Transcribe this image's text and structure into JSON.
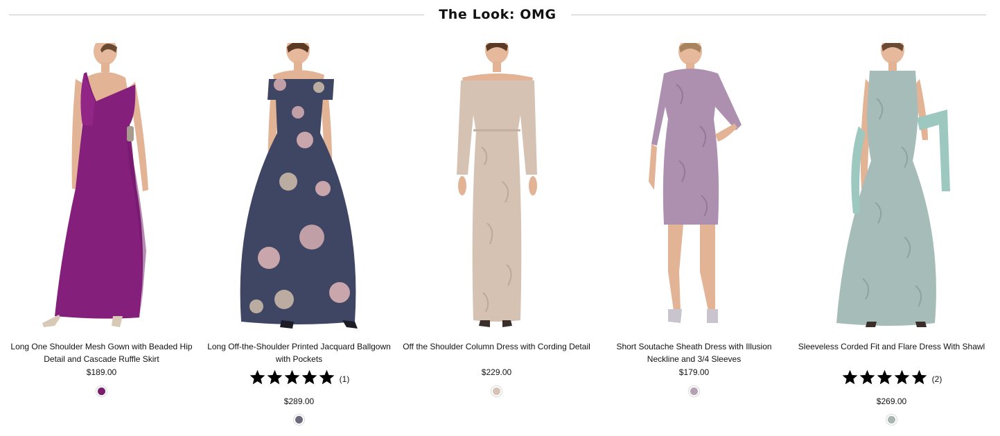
{
  "section": {
    "title": "The Look: OMG"
  },
  "products": [
    {
      "name": "Long One Shoulder Mesh Gown with Beaded Hip Detail and Cascade Ruffle Skirt",
      "price": "$189.00",
      "rating": null,
      "review_count": null,
      "swatch": "#7b1f6d",
      "dress_color": "#851f7c",
      "image_icon": "one-shoulder-gown-image"
    },
    {
      "name": "Long Off-the-Shoulder Printed Jacquard Ballgown with Pockets",
      "price": "$289.00",
      "rating": 5,
      "review_count": "(1)",
      "swatch": "#6e6a7e",
      "dress_color": "#3f4663",
      "image_icon": "floral-ballgown-image"
    },
    {
      "name": "Off the Shoulder Column Dress with Cording Detail",
      "price": "$229.00",
      "rating": null,
      "review_count": null,
      "swatch": "#d7c3b6",
      "dress_color": "#d6c2b3",
      "image_icon": "column-dress-image"
    },
    {
      "name": "Short Soutache Sheath Dress with Illusion Neckline and 3/4 Sleeves",
      "price": "$179.00",
      "rating": null,
      "review_count": null,
      "swatch": "#b6a0b3",
      "dress_color": "#ad8fb0",
      "image_icon": "sheath-dress-image"
    },
    {
      "name": "Sleeveless Corded Fit and Flare Dress With Shawl",
      "price": "$269.00",
      "rating": 5,
      "review_count": "(2)",
      "swatch": "#a9b5b3",
      "dress_color": "#a6bcb8",
      "image_icon": "fit-and-flare-dress-image"
    }
  ]
}
